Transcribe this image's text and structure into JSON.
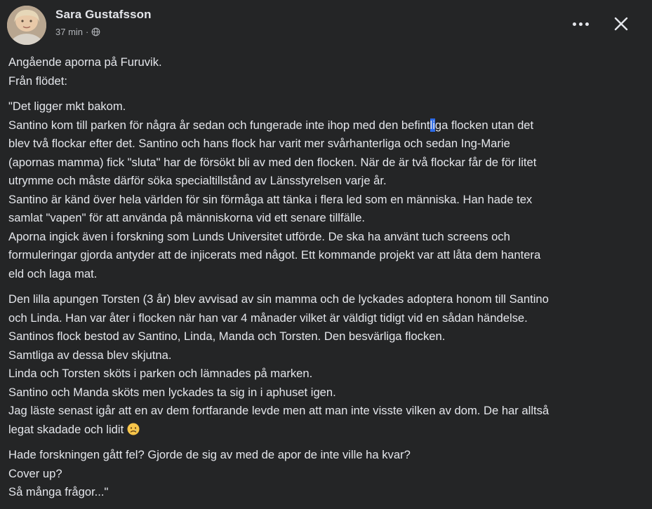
{
  "author": {
    "name": "Sara Gustafsson",
    "time": "37 min",
    "separator": "·",
    "audience_icon": "globe-icon"
  },
  "actions": {
    "more_icon": "more-options-icon",
    "close_icon": "close-icon"
  },
  "post": {
    "intro": [
      "Angående aporna på Furuvik.",
      "Från flödet:"
    ],
    "quote": {
      "l1": "\"Det ligger mkt bakom.",
      "l2_before": "Santino kom till parken för några år sedan och fungerade inte ihop med den befint",
      "l2_highlight": "li",
      "l2_after": "ga flocken utan det",
      "l3": "blev två flockar efter det. Santino och hans flock har varit mer svårhanterliga och sedan Ing-Marie",
      "l4": "(apornas mamma) fick \"sluta\" har de försökt bli av med den flocken. När de är två flockar får de för litet",
      "l5": "utrymme och måste därför söka specialtillstånd av Länsstyrelsen varje år.",
      "l6": "Santino är känd över hela världen för sin förmåga att tänka i flera led som en människa. Han hade tex",
      "l7": "samlat \"vapen\" för att använda på människorna vid ett senare tillfälle.",
      "l8": "Aporna ingick även i forskning som Lunds Universitet utförde. De ska ha använt tuch screens och",
      "l9": "formuleringar gjorda antyder att de injicerats med något. Ett kommande projekt var att låta dem hantera",
      "l10": "eld och laga mat."
    },
    "story": [
      "Den lilla apungen Torsten (3 år) blev avvisad av sin mamma och de lyckades adoptera honom till Santino",
      "och Linda. Han var åter i flocken när han var 4 månader vilket är väldigt tidigt vid en sådan händelse.",
      "Santinos flock bestod av Santino, Linda, Manda och Torsten. Den besvärliga flocken.",
      "Samtliga av dessa blev skjutna.",
      "Linda och Torsten sköts i parken och lämnades på marken.",
      "Santino och Manda sköts men lyckades ta sig in i aphuset igen.",
      "Jag läste senast igår att en av dem fortfarande levde men att man inte visste vilken av dom. De har alltså"
    ],
    "story_last": "legat skadade och lidit",
    "story_emoji": "sad-face-emoji",
    "closing": [
      "Hade forskningen gått fel? Gjorde de sig av med de apor de inte ville ha kvar?",
      "Cover up?",
      "Så många frågor...\""
    ]
  },
  "colors": {
    "background": "#242526",
    "text": "#e4e6eb",
    "secondary": "#b0b3b8",
    "highlight": "#2d6be8"
  }
}
